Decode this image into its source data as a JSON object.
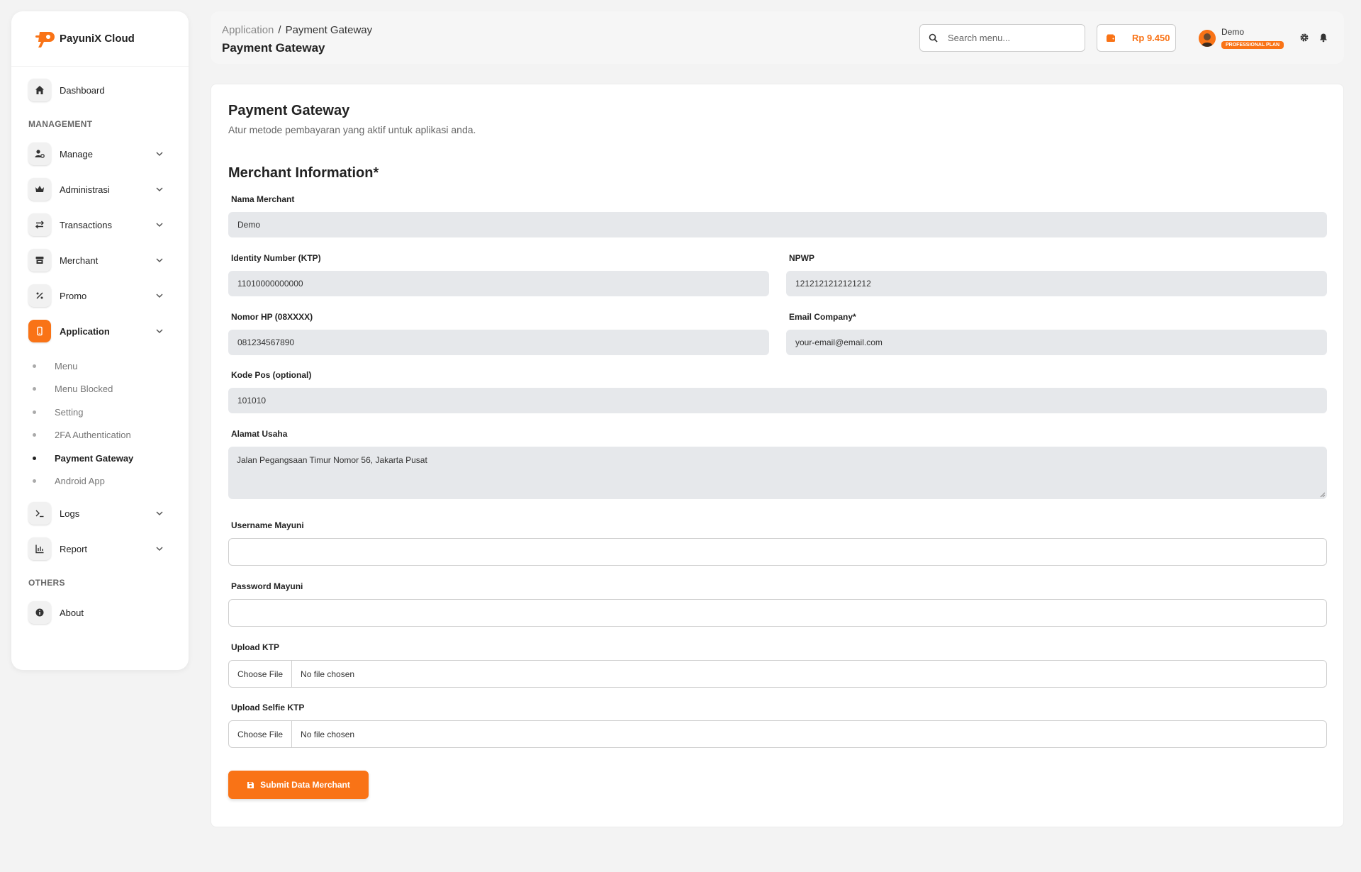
{
  "brand": {
    "name": "PayuniX Cloud"
  },
  "sidebar": {
    "dashboard": "Dashboard",
    "management_title": "MANAGEMENT",
    "items": [
      {
        "label": "Manage",
        "icon": "user-cog-icon"
      },
      {
        "label": "Administrasi",
        "icon": "crown-icon"
      },
      {
        "label": "Transactions",
        "icon": "arrows-exchange-icon"
      },
      {
        "label": "Merchant",
        "icon": "store-icon"
      },
      {
        "label": "Promo",
        "icon": "percent-icon"
      },
      {
        "label": "Application",
        "icon": "mobile-icon"
      }
    ],
    "application_sub": [
      {
        "label": "Menu"
      },
      {
        "label": "Menu Blocked"
      },
      {
        "label": "Setting"
      },
      {
        "label": "2FA Authentication"
      },
      {
        "label": "Payment Gateway"
      },
      {
        "label": "Android App"
      }
    ],
    "logs": "Logs",
    "report": "Report",
    "others_title": "OTHERS",
    "about": "About"
  },
  "header": {
    "breadcrumb_parent": "Application",
    "breadcrumb_sep": "/",
    "breadcrumb_current": "Payment Gateway",
    "title": "Payment Gateway",
    "search_placeholder": "Search menu...",
    "balance": "Rp 9.450",
    "user_name": "Demo",
    "plan": "PROFESSIONAL PLAN"
  },
  "colors": {
    "accent": "#f97316",
    "field_bg": "#e6e8eb"
  },
  "page": {
    "title": "Payment Gateway",
    "subtitle": "Atur metode pembayaran yang aktif untuk aplikasi anda.",
    "section": "Merchant Information*"
  },
  "form": {
    "nama_merchant": {
      "label": "Nama Merchant",
      "value": "Demo"
    },
    "ktp": {
      "label": "Identity Number (KTP)",
      "value": "11010000000000"
    },
    "npwp": {
      "label": "NPWP",
      "value": "1212121212121212"
    },
    "hp": {
      "label": "Nomor HP (08XXXX)",
      "value": "081234567890"
    },
    "email": {
      "label": "Email Company*",
      "value": "your-email@email.com"
    },
    "kodepos": {
      "label": "Kode Pos (optional)",
      "value": "101010"
    },
    "alamat": {
      "label": "Alamat Usaha",
      "value": "Jalan Pegangsaan Timur Nomor 56, Jakarta Pusat"
    },
    "username": {
      "label": "Username Mayuni",
      "value": ""
    },
    "password": {
      "label": "Password Mayuni",
      "value": ""
    },
    "upload_ktp": {
      "label": "Upload KTP",
      "button": "Choose File",
      "status": "No file chosen"
    },
    "upload_selfie": {
      "label": "Upload Selfie KTP",
      "button": "Choose File",
      "status": "No file chosen"
    },
    "submit": "Submit Data Merchant"
  }
}
